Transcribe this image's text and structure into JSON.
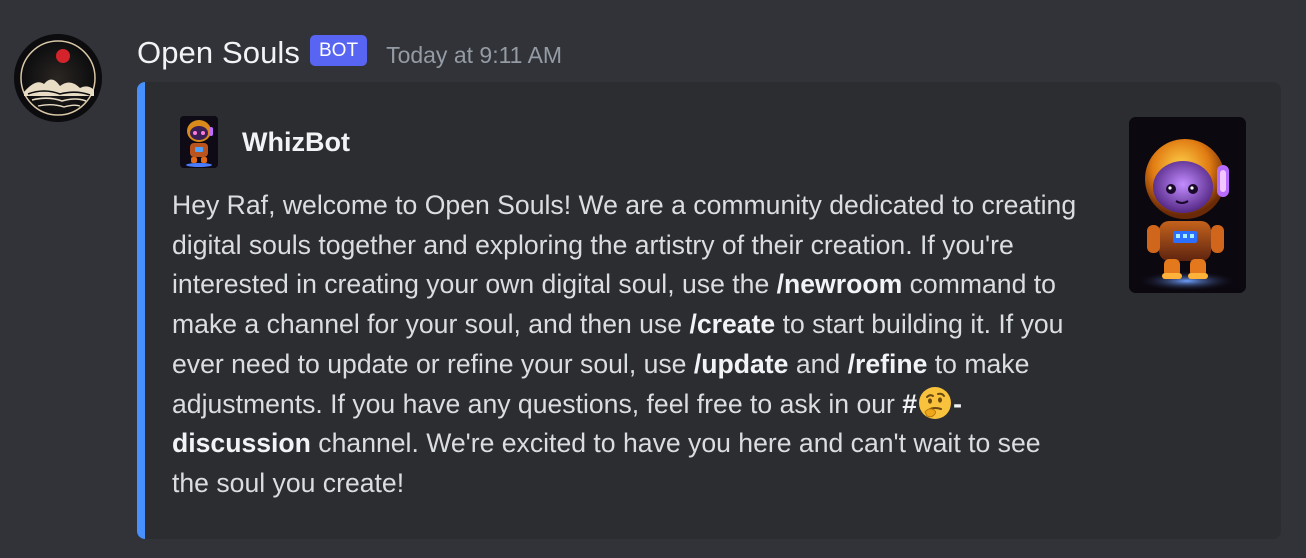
{
  "message": {
    "username": "Open Souls",
    "badge": "BOT",
    "timestamp": "Today at 9:11 AM"
  },
  "embed": {
    "accent_color": "#4990ff",
    "author_name": "WhizBot",
    "segments": [
      {
        "text": "Hey Raf, welcome to Open Souls! We are a community dedicated to creating digital souls together and exploring the artistry of their creation. If you're interested in creating your own digital soul, use the "
      },
      {
        "text": "/newroom",
        "bold": true
      },
      {
        "text": " command to make a channel for your soul, and then use "
      },
      {
        "text": "/create",
        "bold": true
      },
      {
        "text": " to start building it. If you ever need to update or refine your soul, use "
      },
      {
        "text": "/update",
        "bold": true
      },
      {
        "text": " and "
      },
      {
        "text": "/refine",
        "bold": true
      },
      {
        "text": " to make adjustments. If you have any questions, feel free to ask in our "
      },
      {
        "text": "#",
        "bold": true
      },
      {
        "emoji": "thinking-face-icon"
      },
      {
        "text": "-discussion",
        "bold": true
      },
      {
        "text": " channel. We're excited to have you here and can't wait to see the soul you create!"
      }
    ]
  },
  "icons": {
    "avatar": "open-souls-logo-icon",
    "author_icon": "whizbot-robot-icon",
    "thumbnail": "whizbot-robot-icon"
  }
}
